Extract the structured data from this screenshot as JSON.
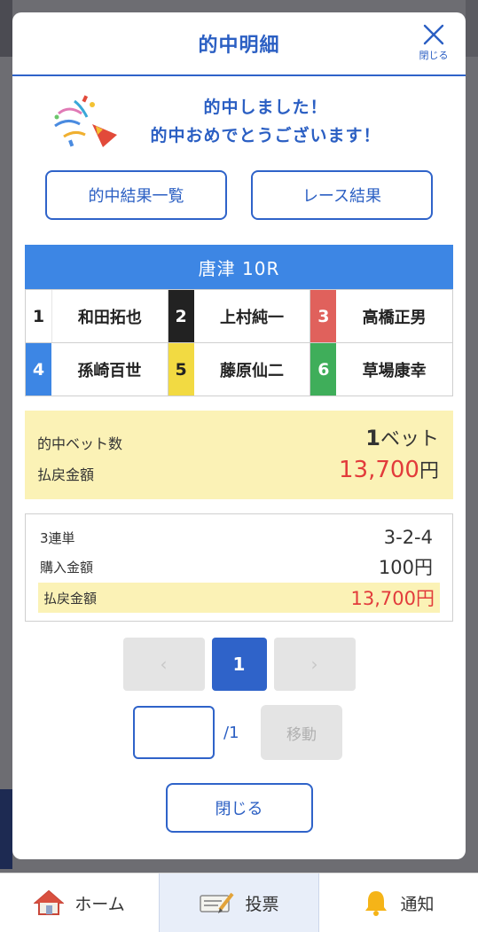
{
  "modal": {
    "title": "的中明細",
    "close_label": "閉じる"
  },
  "congrats": {
    "line1": "的中しました！",
    "line2": "的中おめでとうございます！"
  },
  "buttons": {
    "hit_results": "的中結果一覧",
    "race_results": "レース結果"
  },
  "race": {
    "title": "唐津 10R",
    "racers": [
      {
        "num": "1",
        "name": "和田拓也",
        "bg": "#ffffff",
        "fg": "#222222"
      },
      {
        "num": "2",
        "name": "上村純一",
        "bg": "#222222",
        "fg": "#ffffff"
      },
      {
        "num": "3",
        "name": "高橋正男",
        "bg": "#e0615c",
        "fg": "#ffffff"
      },
      {
        "num": "4",
        "name": "孫崎百世",
        "bg": "#3d86e4",
        "fg": "#ffffff"
      },
      {
        "num": "5",
        "name": "藤原仙二",
        "bg": "#f2da42",
        "fg": "#222222"
      },
      {
        "num": "6",
        "name": "草場康幸",
        "bg": "#3fae5a",
        "fg": "#ffffff"
      }
    ]
  },
  "summary": {
    "bet_count_label": "的中ベット数",
    "bet_count_value": "1",
    "bet_count_unit": "ベット",
    "payout_label": "払戻金額",
    "payout_value": "13,700",
    "payout_unit": "円"
  },
  "detail": {
    "type_label": "3連単",
    "type_value": "3-2-4",
    "purchase_label": "購入金額",
    "purchase_value": "100円",
    "payout_label": "払戻金額",
    "payout_value": "13,700円"
  },
  "pager": {
    "prev": "‹",
    "current": "1",
    "next": "›",
    "total": "/1",
    "jump_label": "移動",
    "jump_value": ""
  },
  "close_button": "閉じる",
  "nav": {
    "home": "ホーム",
    "vote": "投票",
    "notify": "通知"
  },
  "colors": {
    "accent": "#2f63c9",
    "race_header": "#3d86e4",
    "highlight": "#fbf2b6",
    "payout_red": "#e23b3b"
  }
}
